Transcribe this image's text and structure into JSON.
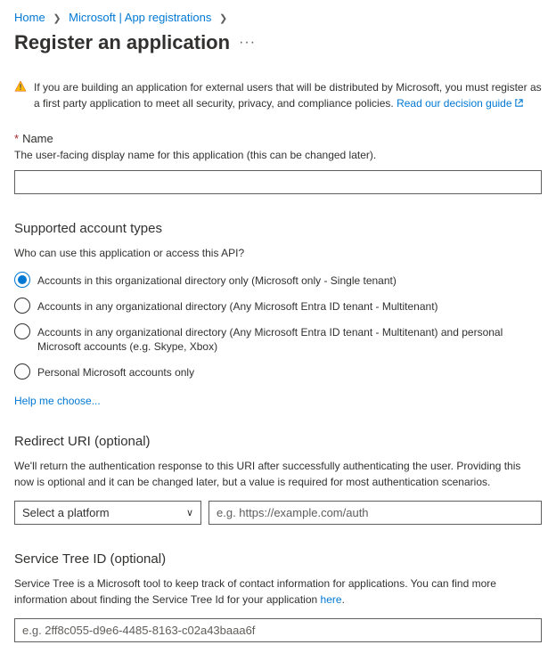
{
  "breadcrumb": {
    "home": "Home",
    "item1": "Microsoft | App registrations"
  },
  "page_title": "Register an application",
  "warning": {
    "text": "If you are building an application for external users that will be distributed by Microsoft, you must register as a first party application to meet all security, privacy, and compliance policies. ",
    "link": "Read our decision guide"
  },
  "name_field": {
    "label": "Name",
    "desc": "The user-facing display name for this application (this can be changed later)."
  },
  "account_types": {
    "title": "Supported account types",
    "question": "Who can use this application or access this API?",
    "options": [
      "Accounts in this organizational directory only (Microsoft only - Single tenant)",
      "Accounts in any organizational directory (Any Microsoft Entra ID tenant - Multitenant)",
      "Accounts in any organizational directory (Any Microsoft Entra ID tenant - Multitenant) and personal Microsoft accounts (e.g. Skype, Xbox)",
      "Personal Microsoft accounts only"
    ],
    "help_link": "Help me choose..."
  },
  "redirect_uri": {
    "title": "Redirect URI (optional)",
    "desc": "We'll return the authentication response to this URI after successfully authenticating the user. Providing this now is optional and it can be changed later, but a value is required for most authentication scenarios.",
    "platform_placeholder": "Select a platform",
    "uri_placeholder": "e.g. https://example.com/auth"
  },
  "service_tree": {
    "title": "Service Tree ID (optional)",
    "desc_prefix": "Service Tree is a Microsoft tool to keep track of contact information for applications. You can find more information about finding the Service Tree Id for your application ",
    "desc_link": "here",
    "desc_suffix": ".",
    "placeholder": "e.g. 2ff8c055-d9e6-4485-8163-c02a43baaa6f"
  }
}
